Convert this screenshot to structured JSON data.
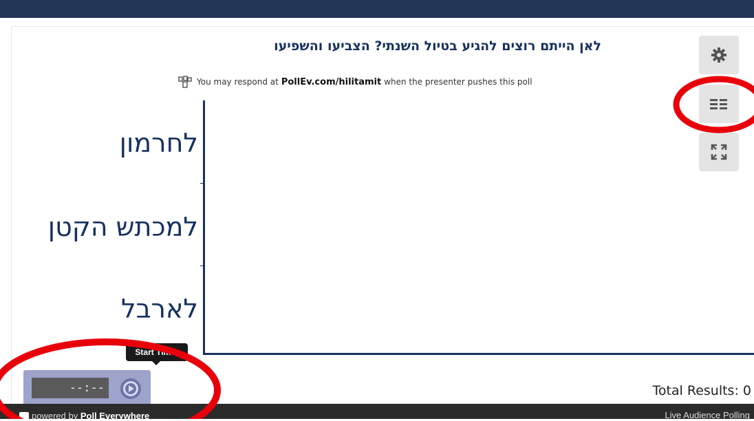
{
  "poll": {
    "title": "לאן הייתם רוצים להגיע בטיול השנתי? הצביעו והשפיעו",
    "respond_prefix": "You may respond at",
    "respond_url": "PollEv.com/hilitamit",
    "respond_suffix": "when the presenter pushes this poll"
  },
  "chart": {
    "categories": [
      "לחרמון",
      "למכתש הקטן",
      "לארבל"
    ],
    "zero_label": "0"
  },
  "chart_data": {
    "type": "bar",
    "orientation": "horizontal",
    "categories": [
      "לחרמון",
      "למכתש הקטן",
      "לארבל"
    ],
    "values": [
      0,
      0,
      0
    ],
    "xlim": [
      0,
      null
    ]
  },
  "toolbar": {
    "settings_icon": "gear-icon",
    "layout_icon": "list-layout-icon",
    "expand_icon": "expand-icon"
  },
  "timer": {
    "tooltip": "Start Timer",
    "display": "--:--",
    "play_icon": "play-icon"
  },
  "footer": {
    "total_results": "Total Results: 0",
    "powered_prefix": "powered by",
    "powered_brand": "Poll Everywhere",
    "live": "Live Audience Polling"
  },
  "colors": {
    "accent": "#16315f",
    "topbar": "#233656",
    "annotation": "#e8000b"
  }
}
